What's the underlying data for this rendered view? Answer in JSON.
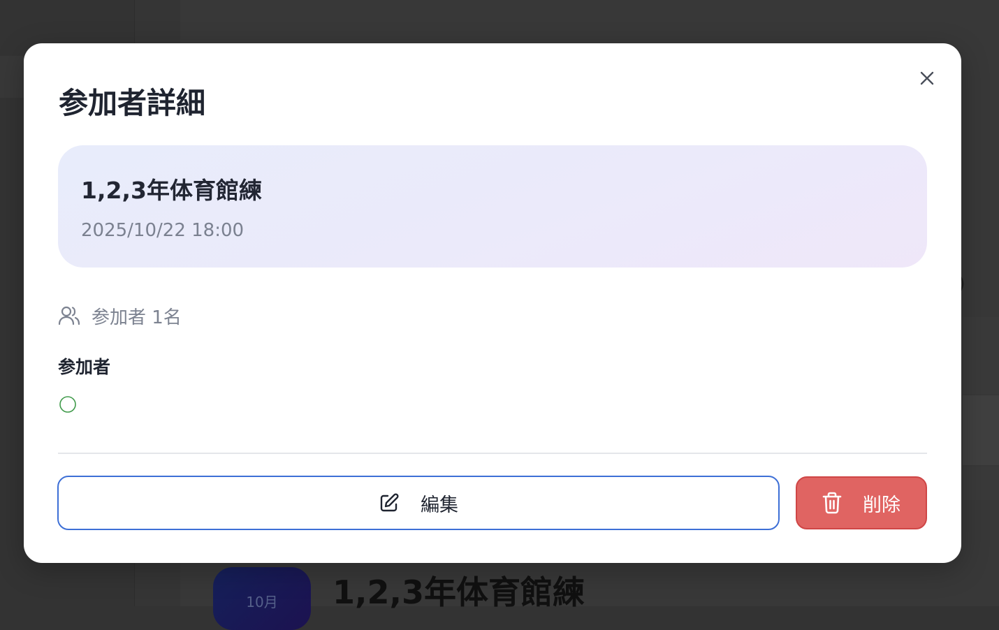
{
  "background": {
    "event_title": "1,2,3年体育館練",
    "date_badge_month": "10月",
    "partial_text": ")"
  },
  "modal": {
    "title": "参加者詳細",
    "close_icon": "close-icon",
    "event": {
      "title": "1,2,3年体育館練",
      "datetime": "2025/10/22 18:00"
    },
    "participant_count": {
      "icon": "users-icon",
      "text": "参加者 1名"
    },
    "participants_section": {
      "label": "参加者",
      "items": [
        {
          "status_icon": "circle-attending-icon",
          "name": ""
        }
      ]
    },
    "actions": {
      "edit_label": "編集",
      "edit_icon": "edit-icon",
      "delete_label": "削除",
      "delete_icon": "trash-icon"
    }
  },
  "colors": {
    "overlay": "#333333",
    "modal_bg": "#ffffff",
    "card_gradient_start": "#e8ecfb",
    "card_gradient_end": "#efe7f9",
    "primary_border": "#3d6fd6",
    "danger": "#e06462",
    "attending_green": "#3f9a4a",
    "text_dark": "#1f2430",
    "text_muted": "#7b8190"
  }
}
